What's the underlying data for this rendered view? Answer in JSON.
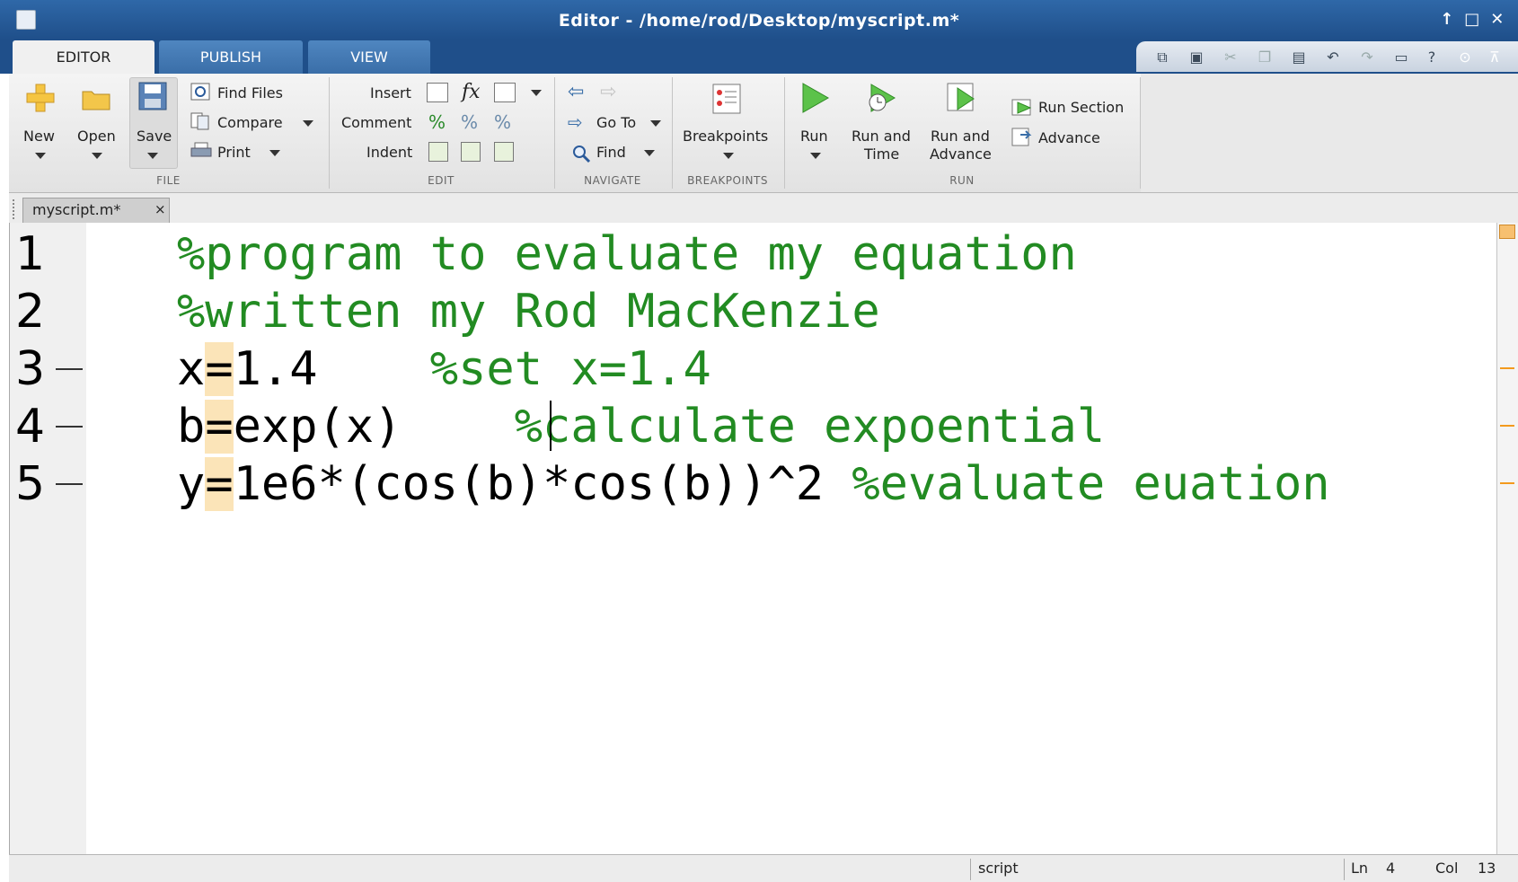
{
  "window": {
    "title": "Editor - /home/rod/Desktop/myscript.m*"
  },
  "tabs": [
    "EDITOR",
    "PUBLISH",
    "VIEW"
  ],
  "ribbon": {
    "file": {
      "label": "FILE",
      "new": "New",
      "open": "Open",
      "save": "Save",
      "find_files": "Find Files",
      "compare": "Compare",
      "print": "Print"
    },
    "edit": {
      "label": "EDIT",
      "insert": "Insert",
      "comment": "Comment",
      "indent": "Indent",
      "fx": "fx"
    },
    "navigate": {
      "label": "NAVIGATE",
      "goto": "Go To",
      "find": "Find"
    },
    "breakpoints": {
      "label": "BREAKPOINTS",
      "button": "Breakpoints"
    },
    "run": {
      "label": "RUN",
      "run": "Run",
      "run_and_time_1": "Run and",
      "run_and_time_2": "Time",
      "run_and_advance_1": "Run and",
      "run_and_advance_2": "Advance",
      "run_section": "Run Section",
      "advance": "Advance"
    }
  },
  "document_tab": {
    "name": "myscript.m*",
    "close": "×"
  },
  "editor": {
    "lines": [
      {
        "num": "1",
        "code": "",
        "eq": "",
        "rest": "",
        "comment": "%program to evaluate my equation"
      },
      {
        "num": "2",
        "code": "",
        "eq": "",
        "rest": "",
        "comment": "%written my Rod MacKenzie"
      },
      {
        "num": "3",
        "code": "x",
        "eq": "=",
        "rest": "1.4    ",
        "comment": "%set x=1.4"
      },
      {
        "num": "4",
        "code": "b",
        "eq": "=",
        "rest": "exp(x)    ",
        "comment": "%calculate expoential"
      },
      {
        "num": "5",
        "code": "y",
        "eq": "=",
        "rest": "1e6*(cos(b)*cos(b))^2 ",
        "comment": "%evaluate euation"
      }
    ]
  },
  "status": {
    "mode": "script",
    "ln_label": "Ln",
    "ln": "4",
    "col_label": "Col",
    "col": "13"
  },
  "colors": {
    "comment": "#228b22",
    "titlebar": "#1f4f8a",
    "highlight": "#fbe4b8"
  }
}
